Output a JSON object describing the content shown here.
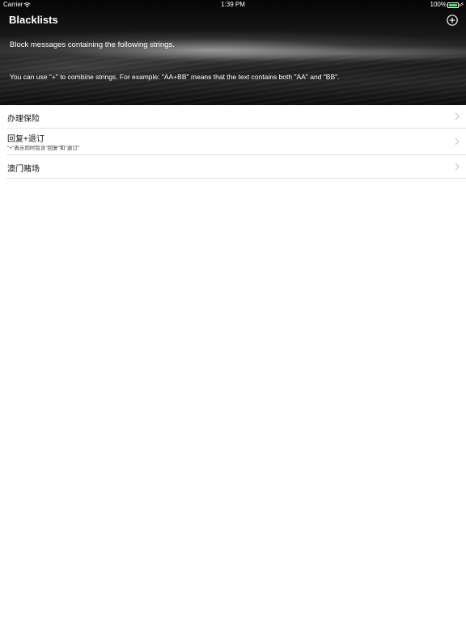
{
  "status_bar": {
    "carrier": "Carrier",
    "time": "1:39 PM",
    "battery": "100%"
  },
  "header": {
    "title": "Blacklists",
    "subtitle": "Block messages containing the following strings.",
    "hint": "You can use \"+\" to combine strings. For example: \"AA+BB\" means that the text contains both \"AA\" and \"BB\"."
  },
  "icons": {
    "add": "plus-circle-icon",
    "chevron": "chevron-right-icon",
    "wifi": "wifi-icon",
    "battery": "battery-icon",
    "charging": "charging-icon"
  },
  "colors": {
    "battery_fill": "#4cd964",
    "separator": "#e2e2e2"
  },
  "blacklist": {
    "items": [
      {
        "title": "办理保险",
        "detail": ""
      },
      {
        "title": "回复+退订",
        "detail": "\"+\"表示同时包含\"回复\"和\"退订\""
      },
      {
        "title": "澳门赌场",
        "detail": ""
      }
    ]
  }
}
